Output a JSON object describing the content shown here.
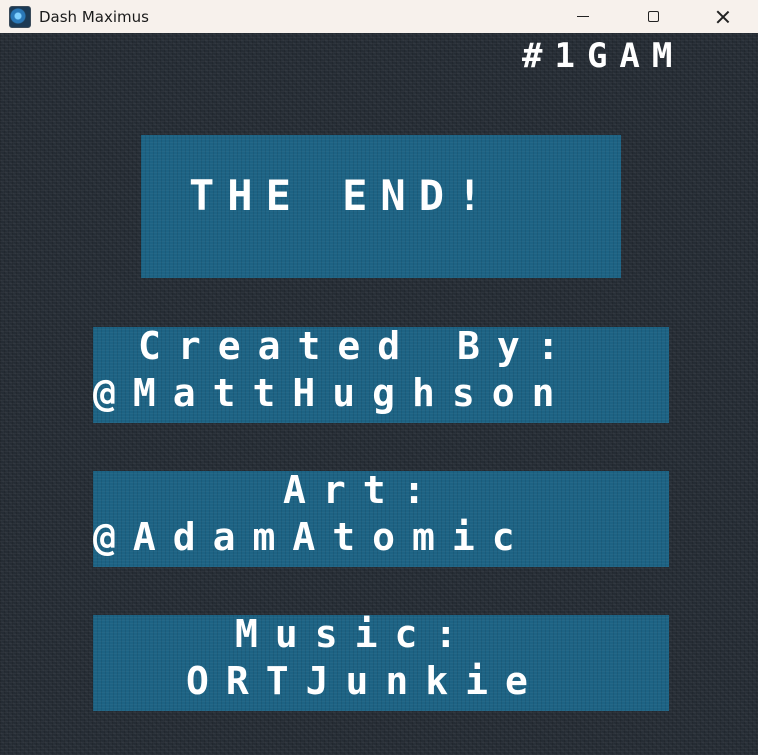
{
  "window": {
    "title": "Dash Maximus",
    "icon": "game-app-icon",
    "controls": {
      "minimize": "minimize-icon",
      "maximize": "maximize-icon",
      "close": "close-icon"
    }
  },
  "game": {
    "jam_tag": "#1GAM",
    "end_screen": {
      "title": "THE END!"
    },
    "credits": [
      {
        "heading": "Created By:",
        "name": "@MattHughson"
      },
      {
        "heading": "Art:",
        "name": "@AdamAtomic"
      },
      {
        "heading": "Music:",
        "name": "ORTJunkie"
      }
    ],
    "colors": {
      "background": "#252c34",
      "panel": "#1d6384",
      "text": "#ffffff"
    }
  }
}
